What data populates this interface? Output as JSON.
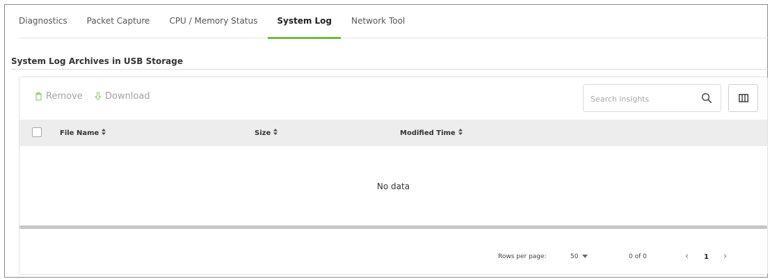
{
  "tabs": [
    {
      "label": "Diagnostics",
      "active": false
    },
    {
      "label": "Packet Capture",
      "active": false
    },
    {
      "label": "CPU / Memory Status",
      "active": false
    },
    {
      "label": "System Log",
      "active": true
    },
    {
      "label": "Network Tool",
      "active": false
    }
  ],
  "section": {
    "title": "System Log Archives in USB Storage"
  },
  "toolbar": {
    "remove_label": "Remove",
    "download_label": "Download",
    "remove_icon": "trash-icon",
    "download_icon": "download-arrow-icon"
  },
  "search": {
    "placeholder": "Search insights",
    "value": ""
  },
  "table": {
    "columns": [
      "File Name",
      "Size",
      "Modified Time"
    ],
    "rows": [],
    "empty_text": "No data"
  },
  "pagination": {
    "rows_per_page_label": "Rows per page:",
    "rows_per_page_value": "50",
    "range_text": "0 of 0",
    "current_page": "1"
  },
  "colors": {
    "accent": "#6cba3f",
    "toolbar_disabled": "#a3a3a3",
    "header_bg": "#ededed"
  }
}
